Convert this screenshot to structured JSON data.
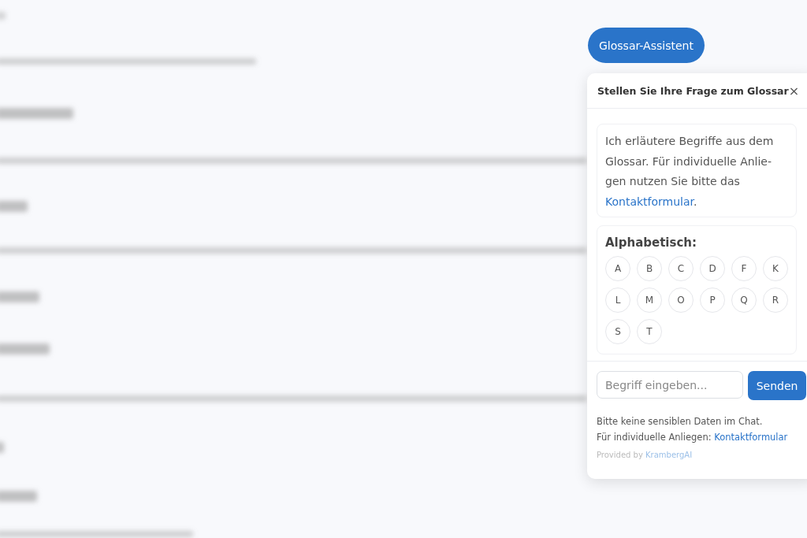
{
  "launcher": {
    "label": "Glossar-Assistent"
  },
  "panel": {
    "title": "Stellen Sie Ihre Frage zum Glossar",
    "close": "×",
    "intro": {
      "text": "Ich erläutere Begriffe aus dem Glossar. Für individuelle Anlie-gen nutzen Sie bitte das ",
      "link": "Kontaktformular",
      "after": "."
    },
    "alphabet": {
      "title": "Alphabetisch:",
      "letters": [
        "A",
        "B",
        "C",
        "D",
        "F",
        "K",
        "L",
        "M",
        "O",
        "P",
        "Q",
        "R",
        "S",
        "T"
      ]
    },
    "input": {
      "placeholder": "Begriff eingeben..."
    },
    "send": "Senden",
    "notice": "Bitte keine sensiblen Daten im Chat.",
    "contact": {
      "text": "Für individuelle Anliegen: ",
      "link": "Kontaktformular"
    },
    "provided": {
      "text": "Provided by ",
      "link": "KrambergAI"
    }
  }
}
